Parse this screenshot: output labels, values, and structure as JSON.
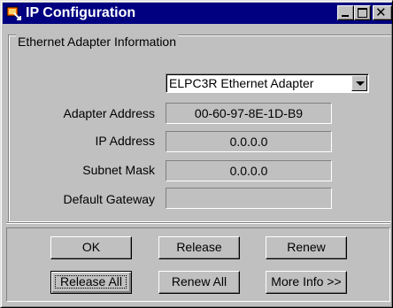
{
  "window": {
    "title": "IP Configuration",
    "title_bar_color": "#000080",
    "controls": [
      "minimize-icon",
      "maximize-icon",
      "close-icon"
    ],
    "close_glyph": "✕"
  },
  "group": {
    "label": "Ethernet  Adapter Information"
  },
  "adapter_select": {
    "value": "ELPC3R Ethernet Adapter"
  },
  "fields": [
    {
      "label": "Adapter Address",
      "value": "00-60-97-8E-1D-B9"
    },
    {
      "label": "IP Address",
      "value": "0.0.0.0"
    },
    {
      "label": "Subnet Mask",
      "value": "0.0.0.0"
    },
    {
      "label": "Default Gateway",
      "value": ""
    }
  ],
  "buttons": {
    "ok": "OK",
    "release": "Release",
    "renew": "Renew",
    "release_all": "Release All",
    "renew_all": "Renew All",
    "more_info": "More Info >>"
  },
  "colors": {
    "face": "#c0c0c0",
    "highlight": "#ffffff",
    "shadow": "#808080"
  }
}
